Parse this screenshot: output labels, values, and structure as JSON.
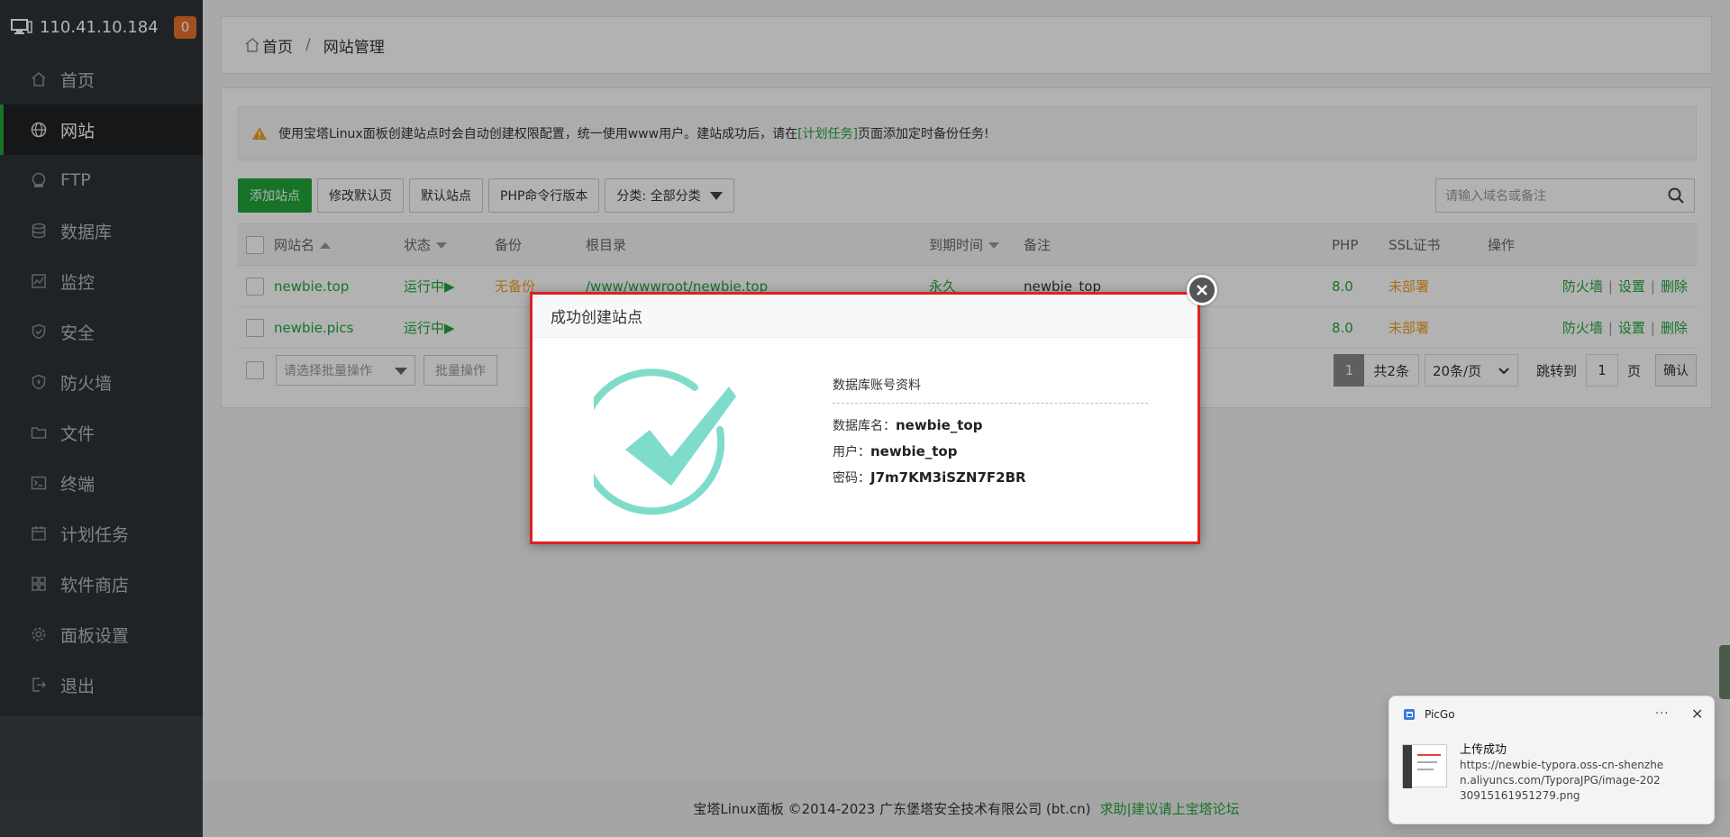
{
  "host": {
    "ip": "110.41.10.184",
    "badge": "0"
  },
  "sidebar": {
    "items": [
      {
        "label": "首页",
        "icon": "home-icon"
      },
      {
        "label": "网站",
        "icon": "globe-icon",
        "active": true
      },
      {
        "label": "FTP",
        "icon": "ftp-icon"
      },
      {
        "label": "数据库",
        "icon": "database-icon"
      },
      {
        "label": "监控",
        "icon": "monitor-icon"
      },
      {
        "label": "安全",
        "icon": "shield-icon"
      },
      {
        "label": "防火墙",
        "icon": "firewall-icon"
      },
      {
        "label": "文件",
        "icon": "folder-icon"
      },
      {
        "label": "终端",
        "icon": "terminal-icon"
      },
      {
        "label": "计划任务",
        "icon": "calendar-icon"
      },
      {
        "label": "软件商店",
        "icon": "grid-icon"
      },
      {
        "label": "面板设置",
        "icon": "gear-icon"
      },
      {
        "label": "退出",
        "icon": "logout-icon"
      }
    ]
  },
  "breadcrumb": {
    "home": "首页",
    "sep": "/",
    "current": "网站管理"
  },
  "notice": {
    "before": "使用宝塔Linux面板创建站点时会自动创建权限配置，统一使用www用户。建站成功后，请在",
    "link": "[计划任务]",
    "after": "页面添加定时备份任务!"
  },
  "toolbar": {
    "add_site": "添加站点",
    "edit_default_page": "修改默认页",
    "default_site": "默认站点",
    "php_cli": "PHP命令行版本",
    "category": "分类: 全部分类"
  },
  "search": {
    "placeholder": "请输入域名或备注"
  },
  "table": {
    "headers": {
      "name": "网站名",
      "status": "状态",
      "backup": "备份",
      "root": "根目录",
      "expire": "到期时间",
      "remark": "备注",
      "php": "PHP",
      "ssl": "SSL证书",
      "ops": "操作"
    },
    "rows": [
      {
        "name": "newbie.top",
        "status": "运行中▶",
        "backup": "无备份",
        "root": "/www/wwwroot/newbie.top",
        "expire": "永久",
        "remark": "newbie_top",
        "php": "8.0",
        "ssl": "未部署",
        "firewall": "防火墙",
        "settings": "设置",
        "delete": "删除"
      },
      {
        "name": "newbie.pics",
        "status": "运行中▶",
        "backup": "",
        "root": "",
        "expire": "",
        "remark": "",
        "php": "8.0",
        "ssl": "未部署",
        "firewall": "防火墙",
        "settings": "设置",
        "delete": "删除"
      }
    ],
    "op_sep": "|"
  },
  "batch": {
    "placeholder": "请选择批量操作",
    "button": "批量操作"
  },
  "pager": {
    "current": "1",
    "total": "共2条",
    "per_page": "20条/页",
    "jump_label": "跳转到",
    "jump_value": "1",
    "unit": "页",
    "confirm": "确认"
  },
  "footer": {
    "copyright": "宝塔Linux面板 ©2014-2023 广东堡塔安全技术有限公司 (bt.cn)",
    "link": "求助|建议请上宝塔论坛"
  },
  "modal": {
    "title": "成功创建站点",
    "info_title": "数据库账号资料",
    "db_name_label": "数据库名：",
    "db_name": "newbie_top",
    "user_label": "用户：",
    "user": "newbie_top",
    "password_label": "密码：",
    "password": "J7m7KM3iSZN7F2BR"
  },
  "toast": {
    "app": "PicGo",
    "more": "···",
    "close": "✕",
    "title": "上传成功",
    "body": "https://newbie-typora.oss-cn-shenzhen.aliyuncs.com/TyporaJPG/image-20230915161951279.png"
  },
  "colors": {
    "accent": "#20a53a",
    "warning": "#f0a020",
    "highlight_border": "#e02020"
  }
}
